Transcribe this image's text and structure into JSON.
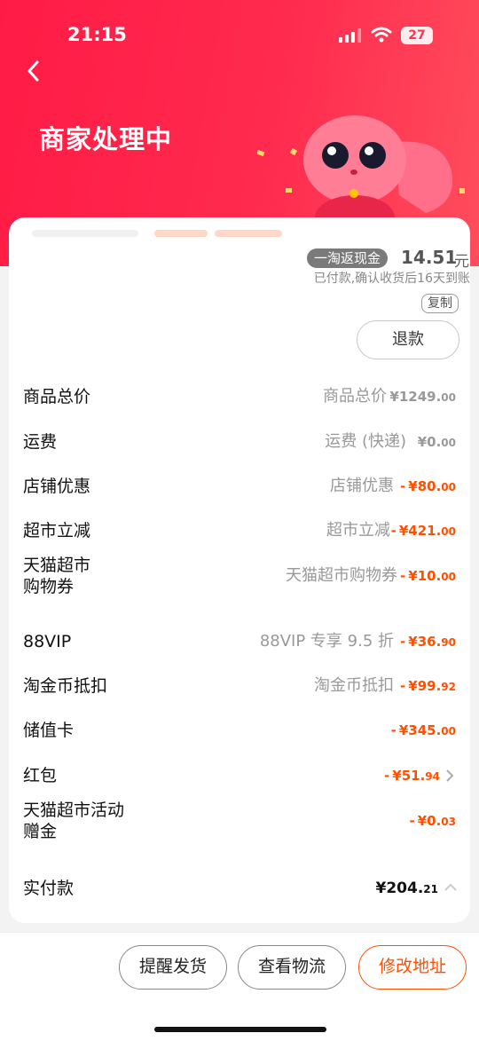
{
  "status_bar": {
    "time": "21:15",
    "battery": "27"
  },
  "header": {
    "title": "商家处理中"
  },
  "cashback": {
    "badge": "一淘返现金",
    "amount": "14.51",
    "unit": "元",
    "note": "已付款,确认收货后16天到账",
    "copy_label": "复制"
  },
  "refund_label": "退款",
  "price_rows": [
    {
      "label": "商品总价",
      "desc": "商品总价",
      "sign": "",
      "amount": "¥1249.",
      "dec": "00",
      "tone": "gray"
    },
    {
      "label": "运费",
      "desc": "运费 (快递)",
      "sign": "",
      "amount": "¥0.",
      "dec": "00",
      "tone": "gray"
    },
    {
      "label": "店铺优惠",
      "desc": "店铺优惠",
      "sign": "-",
      "amount": "¥80.",
      "dec": "00",
      "tone": "orange"
    },
    {
      "label": "超市立减",
      "desc": "超市立减",
      "sign": "-",
      "amount": "¥421.",
      "dec": "00",
      "tone": "orange"
    },
    {
      "label": "天猫超市\n购物券",
      "desc": "天猫超市购物券",
      "sign": "-",
      "amount": "¥10.",
      "dec": "00",
      "tone": "orange"
    },
    {
      "label": "88VIP",
      "desc": "88VIP 专享 9.5 折",
      "sign": "-",
      "amount": "¥36.",
      "dec": "90",
      "tone": "orange"
    },
    {
      "label": "淘金币抵扣",
      "desc": "淘金币抵扣",
      "sign": "-",
      "amount": "¥99.",
      "dec": "92",
      "tone": "orange"
    },
    {
      "label": "储值卡",
      "desc": "",
      "sign": "-",
      "amount": "¥345.",
      "dec": "00",
      "tone": "orange"
    },
    {
      "label": "红包",
      "desc": "",
      "sign": "-",
      "amount": "¥51.",
      "dec": "94",
      "tone": "orange"
    },
    {
      "label": "天猫超市活动\n赠金",
      "desc": "",
      "sign": "-",
      "amount": "¥0.",
      "dec": "03",
      "tone": "orange"
    },
    {
      "label": "实付款",
      "desc": "",
      "sign": "",
      "amount": "¥204.",
      "dec": "21",
      "tone": "black"
    }
  ],
  "bottom_actions": {
    "remind": "提醒发货",
    "logistics": "查看物流",
    "modify_address": "修改地址"
  },
  "colors": {
    "header_red": "#ff1b45",
    "accent_orange": "#ff5000"
  }
}
